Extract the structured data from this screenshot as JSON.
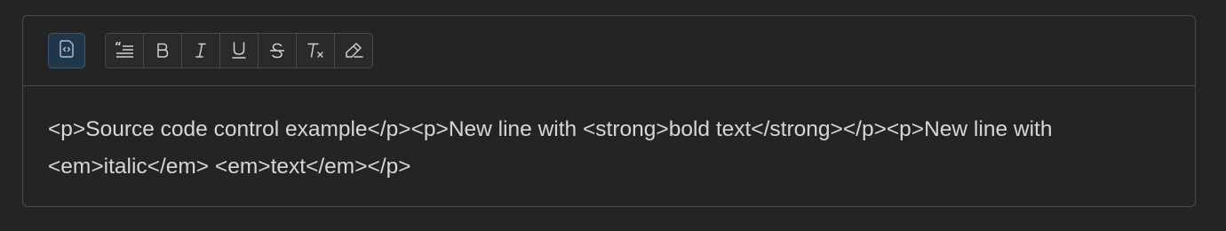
{
  "editor": {
    "content": "<p>Source code control example</p><p>New line with <strong>bold text</strong></p><p>New line with <em>italic</em> <em>text</em></p>"
  },
  "toolbar": {
    "source_button": {
      "icon": "source-code-icon",
      "active": true
    },
    "buttons": [
      {
        "name": "blockquote",
        "icon": "blockquote-icon"
      },
      {
        "name": "bold",
        "icon": "bold-icon"
      },
      {
        "name": "italic",
        "icon": "italic-icon"
      },
      {
        "name": "underline",
        "icon": "underline-icon"
      },
      {
        "name": "strikethrough",
        "icon": "strikethrough-icon"
      },
      {
        "name": "clear-formatting",
        "icon": "clear-formatting-icon"
      },
      {
        "name": "highlight",
        "icon": "highlight-icon"
      }
    ]
  },
  "colors": {
    "background": "#242424",
    "border": "#4a4a4a",
    "text": "#d6d6d6",
    "active_button_bg": "#22364a",
    "icon": "#d0d0d0"
  }
}
